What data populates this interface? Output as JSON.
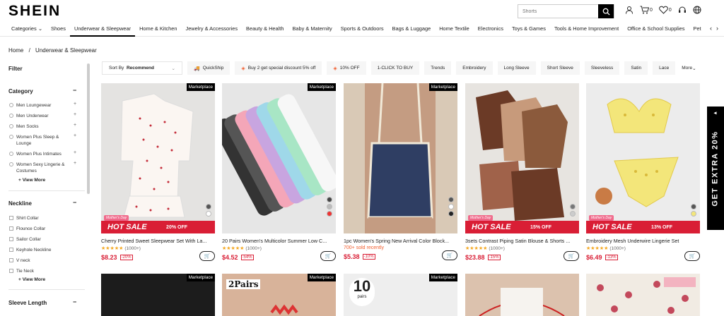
{
  "header": {
    "logo": "SHEIN",
    "search_placeholder": "Shorts",
    "cart_count": "0",
    "wish_count": "0"
  },
  "nav": {
    "items": [
      "Categories",
      "Shoes",
      "Underwear & Sleepwear",
      "Home & Kitchen",
      "Jewelry & Accessories",
      "Beauty & Health",
      "Baby & Maternity",
      "Sports & Outdoors",
      "Bags & Luggage",
      "Home Textile",
      "Electronics",
      "Toys & Games",
      "Tools & Home Improvement",
      "Office & School Supplies",
      "Pet"
    ]
  },
  "breadcrumb": {
    "home": "Home",
    "sep": "/",
    "current": "Underwear & Sleepwear"
  },
  "sidebar": {
    "filter": "Filter",
    "category": "Category",
    "categories": [
      "Men Loungewear",
      "Men Underwear",
      "Men Socks",
      "Women Plus Sleep & Lounge",
      "Women Plus Intimates",
      "Women Sexy Lingerie & Costumes"
    ],
    "view_more": "View More",
    "neckline": "Neckline",
    "necklines": [
      "Shirt Collar",
      "Flounce Collar",
      "Sailor Collar",
      "Keyhole Neckline",
      "V neck",
      "Tie Neck"
    ],
    "view_more2": "View More",
    "sleeve_length": "Sleeve Length"
  },
  "filters": {
    "sort_label": "Sort By",
    "sort_value": "Recommend",
    "chips": [
      "QuickShip",
      "Buy 2 get special discount 5% off",
      "10% OFF",
      "1-CLICK TO BUY",
      "Trends",
      "Embroidery",
      "Long Sleeve",
      "Short Sleeve",
      "Sleeveless",
      "Satin",
      "Lace"
    ],
    "more": "More"
  },
  "products": [
    {
      "badge": "Marketplace",
      "sale": "HOT SALE",
      "off": "20% OFF",
      "mday": "Mother's Day",
      "title": "Cherry Printed Sweet Sleepwear Set With La...",
      "rating": "(1000+)",
      "sold": "",
      "price": "$8.23",
      "disc": "-20%"
    },
    {
      "badge": "Marketplace",
      "sale": "",
      "off": "",
      "mday": "",
      "title": "20 Pairs Women's Multicolor Summer Low C...",
      "rating": "(1000+)",
      "sold": "",
      "price": "$4.52",
      "disc": "-54%"
    },
    {
      "badge": "Marketplace",
      "sale": "",
      "off": "",
      "mday": "",
      "title": "1pc Women's Spring New Arrival Color Block...",
      "rating": "",
      "sold": "700+ sold recently",
      "price": "$5.38",
      "disc": "-10%"
    },
    {
      "badge": "",
      "sale": "HOT SALE",
      "off": "15% OFF",
      "mday": "Mother's Day",
      "title": "3sets Contrast Piping Satin Blouse & Shorts ...",
      "rating": "(1000+)",
      "sold": "",
      "price": "$23.88",
      "disc": "-15%"
    },
    {
      "badge": "",
      "sale": "HOT SALE",
      "off": "13% OFF",
      "mday": "Mother's Day",
      "title": "Embroidery Mesh Underwire Lingerie Set",
      "rating": "(1000+)",
      "sold": "",
      "price": "$6.49",
      "disc": "-13%"
    }
  ],
  "row2": [
    {
      "badge": "Marketplace",
      "text": ""
    },
    {
      "badge": "Marketplace",
      "text": "2Pairs"
    },
    {
      "badge": "Marketplace",
      "text": "10",
      "sub": "pairs"
    },
    {
      "badge": "",
      "text": ""
    },
    {
      "badge": "",
      "text": ""
    }
  ],
  "promo": {
    "text": "GET EXTRA 20%"
  }
}
